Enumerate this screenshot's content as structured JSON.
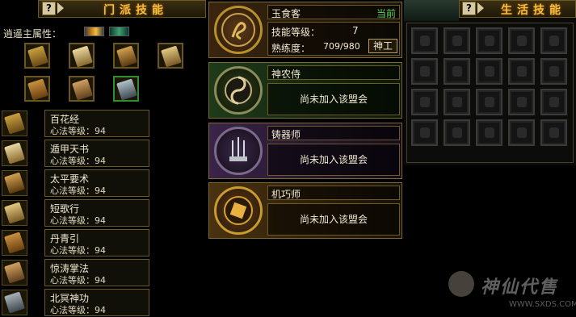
{
  "left_panel": {
    "title": "门派技能",
    "help_label": "?",
    "attr_label": "逍遥主属性：",
    "skills": [
      {
        "name": "百花经",
        "level": "心法等级：94"
      },
      {
        "name": "遁甲天书",
        "level": "心法等级：94"
      },
      {
        "name": "太平要术",
        "level": "心法等级：94"
      },
      {
        "name": "短歌行",
        "level": "心法等级：94"
      },
      {
        "name": "丹青引",
        "level": "心法等级：94"
      },
      {
        "name": "惊涛掌法",
        "level": "心法等级：94"
      },
      {
        "name": "北冥神功",
        "level": "心法等级：94"
      }
    ]
  },
  "guilds": [
    {
      "name": "玉食客",
      "current_label": "当前",
      "skill_level_label": "技能等级：",
      "skill_level_value": "7",
      "proficiency_label": "熟练度：",
      "proficiency_value": "709/980",
      "action_label": "神工"
    },
    {
      "name": "神农侍",
      "status": "尚未加入该盟会"
    },
    {
      "name": "铸器师",
      "status": "尚未加入该盟会"
    },
    {
      "name": "机巧师",
      "status": "尚未加入该盟会"
    }
  ],
  "right_panel": {
    "title": "生活技能",
    "help_label": "?"
  },
  "watermark": {
    "text": "神仙代售",
    "url": "WWW.SXDS.COM"
  },
  "colors": {
    "title_gold": "#f0c040",
    "current_green": "#5fd35f",
    "border_gold": "#6a5a2a"
  }
}
